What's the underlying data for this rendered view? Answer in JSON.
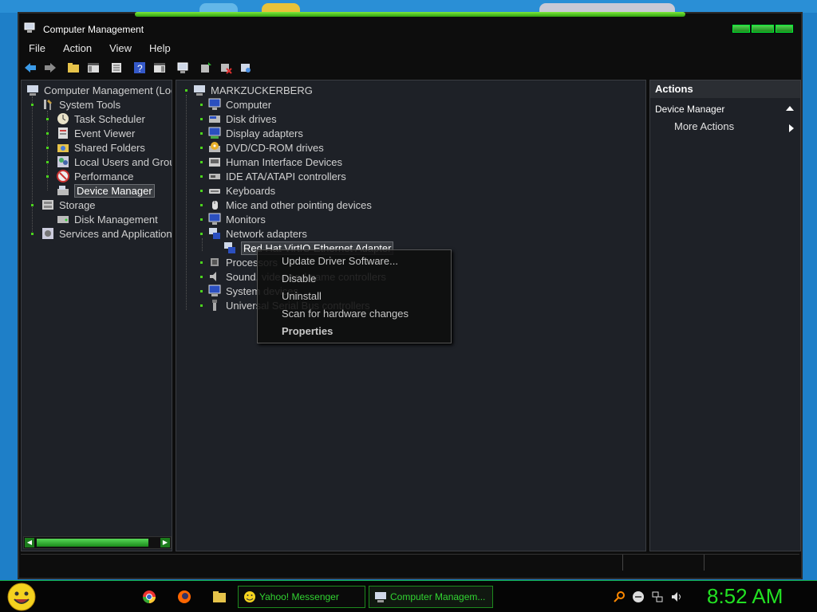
{
  "window": {
    "title": "Computer Management"
  },
  "menu": [
    "File",
    "Action",
    "View",
    "Help"
  ],
  "toolbar_icons": [
    "back-arrow-icon",
    "forward-arrow-icon",
    "folder-up-icon",
    "show-hide-console-tree-icon",
    "export-list-icon",
    "help-icon",
    "show-hide-action-pane-icon",
    "computer-icon",
    "update-driver-icon",
    "uninstall-icon",
    "scan-hardware-icon"
  ],
  "left_tree": [
    {
      "label": "Computer Management (Loc",
      "icon": "computer-management-icon"
    },
    {
      "label": "System Tools",
      "icon": "tools-icon"
    },
    {
      "label": "Task Scheduler",
      "icon": "clock-icon"
    },
    {
      "label": "Event Viewer",
      "icon": "event-viewer-icon"
    },
    {
      "label": "Shared Folders",
      "icon": "shared-folder-icon"
    },
    {
      "label": "Local Users and Grou",
      "icon": "users-icon"
    },
    {
      "label": "Performance",
      "icon": "performance-icon"
    },
    {
      "label": "Device Manager",
      "icon": "device-manager-icon"
    },
    {
      "label": "Storage",
      "icon": "storage-icon"
    },
    {
      "label": "Disk Management",
      "icon": "disk-icon"
    },
    {
      "label": "Services and Applications",
      "icon": "services-icon"
    }
  ],
  "device_tree": [
    {
      "label": "MARKZUCKERBERG",
      "icon": "computer-icon"
    },
    {
      "label": "Computer",
      "icon": "monitor-icon"
    },
    {
      "label": "Disk drives",
      "icon": "disk-drive-icon"
    },
    {
      "label": "Display adapters",
      "icon": "display-adapter-icon"
    },
    {
      "label": "DVD/CD-ROM drives",
      "icon": "dvd-icon"
    },
    {
      "label": "Human Interface Devices",
      "icon": "hid-icon"
    },
    {
      "label": "IDE ATA/ATAPI controllers",
      "icon": "ide-icon"
    },
    {
      "label": "Keyboards",
      "icon": "keyboard-icon"
    },
    {
      "label": "Mice and other pointing devices",
      "icon": "mouse-icon"
    },
    {
      "label": "Monitors",
      "icon": "monitor-icon"
    },
    {
      "label": "Network adapters",
      "icon": "network-icon"
    },
    {
      "label": "Red Hat VirtIO Ethernet Adapter",
      "icon": "network-adapter-icon"
    },
    {
      "label": "Processors",
      "icon": "processor-icon"
    },
    {
      "label": "Sound, video and game controllers",
      "icon": "sound-icon"
    },
    {
      "label": "System devices",
      "icon": "system-devices-icon"
    },
    {
      "label": "Universal Serial Bus controllers",
      "icon": "usb-icon"
    }
  ],
  "context_menu": [
    "Update Driver Software...",
    "Disable",
    "Uninstall",
    "Scan for hardware changes",
    "Properties"
  ],
  "actions": {
    "header": "Actions",
    "section": "Device Manager",
    "more": "More Actions"
  },
  "taskbar": {
    "buttons": [
      "Yahoo! Messenger",
      "Computer Managem..."
    ],
    "clock": "8:52 AM"
  },
  "colors": {
    "accent_green": "#22e022",
    "pane_bg": "#1e2127",
    "window_bg": "#0d0d0d",
    "desktop": "#1e7fc8"
  }
}
